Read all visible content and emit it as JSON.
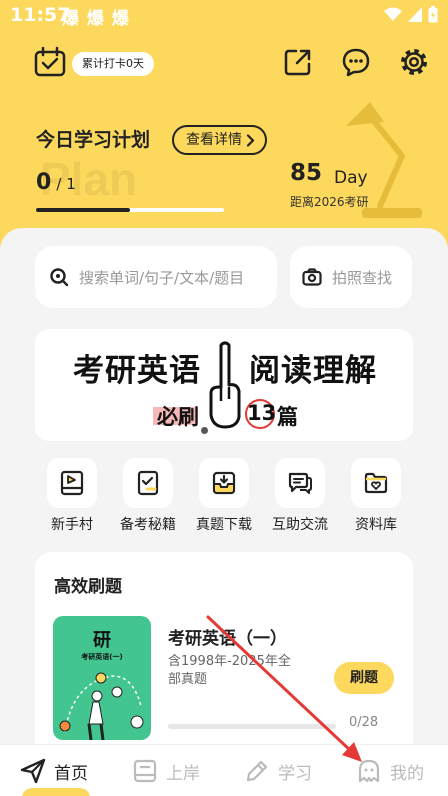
{
  "status_bar": {
    "time": "11:57",
    "notifications": "爆 爆 爆"
  },
  "header": {
    "checkin_label": "累计打卡0天",
    "icons": [
      "calendar-check-icon",
      "share-icon",
      "message-icon",
      "settings-gear-icon"
    ]
  },
  "plan": {
    "title": "今日学习计划",
    "detail_button": "查看详情",
    "background_word": "Plan",
    "done": "0",
    "total": "/ 1",
    "progress_fraction": 0.5,
    "days": "85",
    "days_unit": "Day",
    "days_label": "距离2026考研"
  },
  "search": {
    "placeholder": "搜索单词/句子/文本/题目",
    "photo_search_label": "拍照查找"
  },
  "banner": {
    "part1": "考研英语",
    "part2": "阅读理解",
    "sub1": "必刷",
    "number": "13",
    "sub2": "篇"
  },
  "quick_links": [
    {
      "label": "新手村",
      "icon": "book-flag-icon"
    },
    {
      "label": "备考秘籍",
      "icon": "checklist-icon"
    },
    {
      "label": "真题下载",
      "icon": "download-tray-icon"
    },
    {
      "label": "互助交流",
      "icon": "chat-bubbles-icon"
    },
    {
      "label": "资料库",
      "icon": "folder-heart-icon"
    }
  ],
  "practice_card": {
    "title": "高效刷题",
    "book_title": "研",
    "book_subtitle": "考研英语(一)",
    "course_title": "考研英语（一）",
    "course_desc": "含1998年-2025年全部真题",
    "practice_button": "刷题",
    "progress_text": "0/28",
    "progress_fraction": 0
  },
  "bottom_nav": [
    {
      "label": "首页",
      "icon": "paper-plane-icon",
      "active": true
    },
    {
      "label": "上岸",
      "icon": "book-icon",
      "active": false
    },
    {
      "label": "学习",
      "icon": "pen-icon",
      "active": false
    },
    {
      "label": "我的",
      "icon": "ghost-profile-icon",
      "active": false
    }
  ],
  "colors": {
    "brand_yellow": "#fcd85c",
    "annotation_red": "#e53935",
    "book_green": "#43c590"
  }
}
